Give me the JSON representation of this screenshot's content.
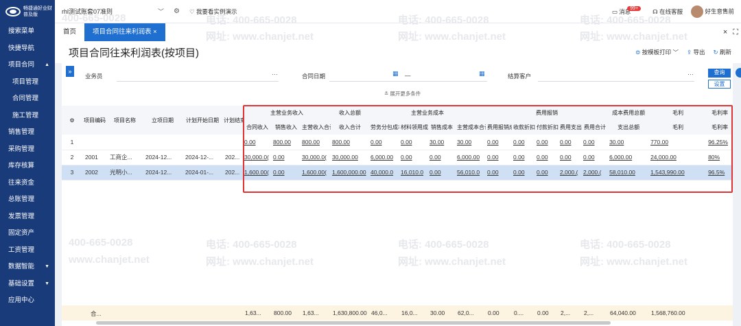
{
  "app": {
    "logo_text": "畅捷通好业财\n普及版"
  },
  "sidebar": {
    "items": [
      {
        "label": "搜索菜单"
      },
      {
        "label": "快捷导航"
      },
      {
        "label": "项目合同",
        "caret": "▲"
      },
      {
        "label": "项目管理",
        "sub": true
      },
      {
        "label": "合同管理",
        "sub": true
      },
      {
        "label": "施工管理",
        "sub": true
      },
      {
        "label": "销售管理"
      },
      {
        "label": "采购管理"
      },
      {
        "label": "库存核算"
      },
      {
        "label": "往来资金"
      },
      {
        "label": "总账管理"
      },
      {
        "label": "发票管理"
      },
      {
        "label": "固定资产"
      },
      {
        "label": "工资管理"
      },
      {
        "label": "数据智能",
        "caret": "▼"
      },
      {
        "label": "基础设置",
        "caret": "▼"
      },
      {
        "label": "应用中心"
      }
    ]
  },
  "topbar": {
    "account": "rhl测试账套07准则",
    "demo_tip": "我要看实例演示",
    "messages_label": "消息",
    "messages_count": "99+",
    "support_label": "在线客服",
    "user_label": "好生意售前"
  },
  "tabs": [
    {
      "label": "首页",
      "active": false
    },
    {
      "label": "项目合同往来利润表 ×",
      "active": true
    }
  ],
  "page": {
    "title": "项目合同往来利润表(按项目)",
    "actions": [
      "按模板打印",
      "导出",
      "刷新"
    ]
  },
  "filters": {
    "salesperson_label": "业务员",
    "contract_date_label": "合同日期",
    "date_separator": "—",
    "customer_label": "结算客户",
    "query_button": "查询",
    "settings_button": "设置",
    "more_conditions": "展开更多条件",
    "dots": "···"
  },
  "table": {
    "group_headers": [
      "主营业务收入",
      "收入总额",
      "主营业务成本",
      "费用报销",
      "成本费用总额",
      "毛利",
      "毛利率"
    ],
    "columns": [
      "",
      "项目编码",
      "项目名称",
      "立项日期",
      "计划开始日期",
      "计划结束日期",
      "合同收入",
      "销售收入",
      "主营收入合计",
      "收入合计",
      "劳务分包成本",
      "材料领用成本",
      "销售成本",
      "主营成本合计",
      "费用报销成本",
      "收款折扣",
      "付款折扣",
      "费用支出",
      "费用合计",
      "支出总额",
      "毛利",
      "毛利率"
    ],
    "rows": [
      {
        "idx": "1",
        "code": "",
        "name": "",
        "created": "",
        "plan_start": "",
        "plan_end": "",
        "v": [
          "0.00",
          "800.00",
          "800.00",
          "800.00",
          "0.00",
          "0.00",
          "30.00",
          "30.00",
          "0.00",
          "0.00",
          "0.00",
          "0.00",
          "0.00",
          "30.00",
          "770.00",
          "96.25%"
        ],
        "selected": false
      },
      {
        "idx": "2",
        "code": "2001",
        "name": "工商企...",
        "created": "2024-12...",
        "plan_start": "2024-12-...",
        "plan_end": "202...",
        "v": [
          "30,000.0(",
          "0.00",
          "30,000.0(",
          "30,000.00",
          "6,000.00",
          "0.00",
          "0.00",
          "6,000.00",
          "0.00",
          "0.00",
          "0.00",
          "0.00",
          "0.00",
          "6,000.00",
          "24,000.00",
          "80%"
        ],
        "selected": false
      },
      {
        "idx": "3",
        "code": "2002",
        "name": "光明小...",
        "created": "2024-12...",
        "plan_start": "2024-01-...",
        "plan_end": "202...",
        "v": [
          "1,600.00(",
          "0.00",
          "1,600.00(",
          "1,600,000.00",
          "40,000.0",
          "16,010.0",
          "0.00",
          "56,010.0",
          "0.00",
          "0.00",
          "0.00",
          "2,000.(",
          "2,000.(",
          "58,010.00",
          "1,543,990.00",
          "96.5%"
        ],
        "selected": true
      }
    ],
    "footer": {
      "label": "合...",
      "v": [
        "1,63...",
        "800.00",
        "1,63...",
        "1,630,800.00",
        "46,0...",
        "16,0...",
        "30.00",
        "62,0...",
        "0.00",
        "0....",
        "0.00",
        "2,...",
        "2,...",
        "64,040.00",
        "1,568,760.00"
      ]
    }
  },
  "watermark": {
    "phone": "电话: 400-665-0028",
    "site": "网址: www.chanjet.net",
    "phone_short": "400-665-0028",
    "site_short": "www.chanjet.net"
  },
  "colors": {
    "sidebar": "#1a3b7a",
    "accent": "#1f6fd1",
    "highlight_box": "#e03333",
    "selected_row": "#cfe0f5",
    "footer": "#fdf3e1"
  }
}
